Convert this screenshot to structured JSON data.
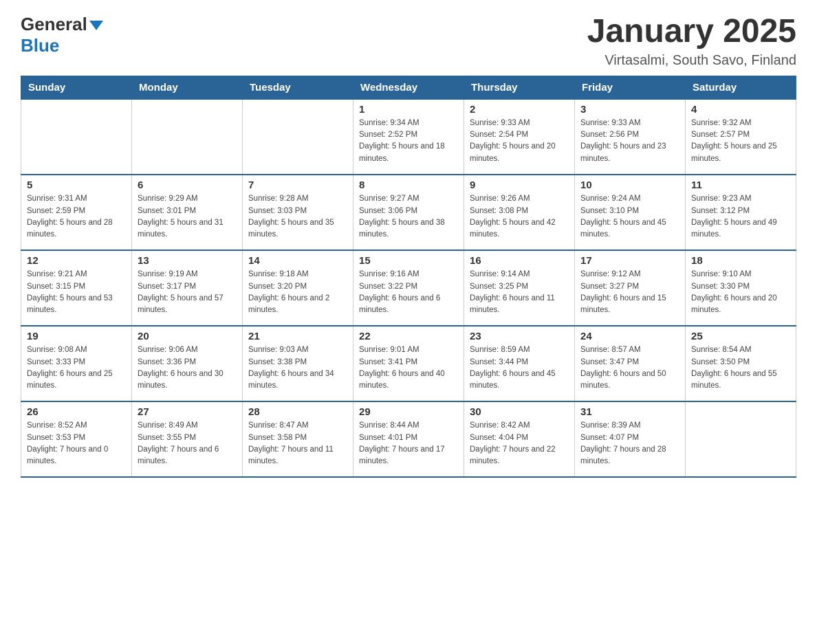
{
  "header": {
    "logo_general": "General",
    "logo_blue": "Blue",
    "month_title": "January 2025",
    "location": "Virtasalmi, South Savo, Finland"
  },
  "days_of_week": [
    "Sunday",
    "Monday",
    "Tuesday",
    "Wednesday",
    "Thursday",
    "Friday",
    "Saturday"
  ],
  "weeks": [
    [
      {
        "day": "",
        "sunrise": "",
        "sunset": "",
        "daylight": ""
      },
      {
        "day": "",
        "sunrise": "",
        "sunset": "",
        "daylight": ""
      },
      {
        "day": "",
        "sunrise": "",
        "sunset": "",
        "daylight": ""
      },
      {
        "day": "1",
        "sunrise": "Sunrise: 9:34 AM",
        "sunset": "Sunset: 2:52 PM",
        "daylight": "Daylight: 5 hours and 18 minutes."
      },
      {
        "day": "2",
        "sunrise": "Sunrise: 9:33 AM",
        "sunset": "Sunset: 2:54 PM",
        "daylight": "Daylight: 5 hours and 20 minutes."
      },
      {
        "day": "3",
        "sunrise": "Sunrise: 9:33 AM",
        "sunset": "Sunset: 2:56 PM",
        "daylight": "Daylight: 5 hours and 23 minutes."
      },
      {
        "day": "4",
        "sunrise": "Sunrise: 9:32 AM",
        "sunset": "Sunset: 2:57 PM",
        "daylight": "Daylight: 5 hours and 25 minutes."
      }
    ],
    [
      {
        "day": "5",
        "sunrise": "Sunrise: 9:31 AM",
        "sunset": "Sunset: 2:59 PM",
        "daylight": "Daylight: 5 hours and 28 minutes."
      },
      {
        "day": "6",
        "sunrise": "Sunrise: 9:29 AM",
        "sunset": "Sunset: 3:01 PM",
        "daylight": "Daylight: 5 hours and 31 minutes."
      },
      {
        "day": "7",
        "sunrise": "Sunrise: 9:28 AM",
        "sunset": "Sunset: 3:03 PM",
        "daylight": "Daylight: 5 hours and 35 minutes."
      },
      {
        "day": "8",
        "sunrise": "Sunrise: 9:27 AM",
        "sunset": "Sunset: 3:06 PM",
        "daylight": "Daylight: 5 hours and 38 minutes."
      },
      {
        "day": "9",
        "sunrise": "Sunrise: 9:26 AM",
        "sunset": "Sunset: 3:08 PM",
        "daylight": "Daylight: 5 hours and 42 minutes."
      },
      {
        "day": "10",
        "sunrise": "Sunrise: 9:24 AM",
        "sunset": "Sunset: 3:10 PM",
        "daylight": "Daylight: 5 hours and 45 minutes."
      },
      {
        "day": "11",
        "sunrise": "Sunrise: 9:23 AM",
        "sunset": "Sunset: 3:12 PM",
        "daylight": "Daylight: 5 hours and 49 minutes."
      }
    ],
    [
      {
        "day": "12",
        "sunrise": "Sunrise: 9:21 AM",
        "sunset": "Sunset: 3:15 PM",
        "daylight": "Daylight: 5 hours and 53 minutes."
      },
      {
        "day": "13",
        "sunrise": "Sunrise: 9:19 AM",
        "sunset": "Sunset: 3:17 PM",
        "daylight": "Daylight: 5 hours and 57 minutes."
      },
      {
        "day": "14",
        "sunrise": "Sunrise: 9:18 AM",
        "sunset": "Sunset: 3:20 PM",
        "daylight": "Daylight: 6 hours and 2 minutes."
      },
      {
        "day": "15",
        "sunrise": "Sunrise: 9:16 AM",
        "sunset": "Sunset: 3:22 PM",
        "daylight": "Daylight: 6 hours and 6 minutes."
      },
      {
        "day": "16",
        "sunrise": "Sunrise: 9:14 AM",
        "sunset": "Sunset: 3:25 PM",
        "daylight": "Daylight: 6 hours and 11 minutes."
      },
      {
        "day": "17",
        "sunrise": "Sunrise: 9:12 AM",
        "sunset": "Sunset: 3:27 PM",
        "daylight": "Daylight: 6 hours and 15 minutes."
      },
      {
        "day": "18",
        "sunrise": "Sunrise: 9:10 AM",
        "sunset": "Sunset: 3:30 PM",
        "daylight": "Daylight: 6 hours and 20 minutes."
      }
    ],
    [
      {
        "day": "19",
        "sunrise": "Sunrise: 9:08 AM",
        "sunset": "Sunset: 3:33 PM",
        "daylight": "Daylight: 6 hours and 25 minutes."
      },
      {
        "day": "20",
        "sunrise": "Sunrise: 9:06 AM",
        "sunset": "Sunset: 3:36 PM",
        "daylight": "Daylight: 6 hours and 30 minutes."
      },
      {
        "day": "21",
        "sunrise": "Sunrise: 9:03 AM",
        "sunset": "Sunset: 3:38 PM",
        "daylight": "Daylight: 6 hours and 34 minutes."
      },
      {
        "day": "22",
        "sunrise": "Sunrise: 9:01 AM",
        "sunset": "Sunset: 3:41 PM",
        "daylight": "Daylight: 6 hours and 40 minutes."
      },
      {
        "day": "23",
        "sunrise": "Sunrise: 8:59 AM",
        "sunset": "Sunset: 3:44 PM",
        "daylight": "Daylight: 6 hours and 45 minutes."
      },
      {
        "day": "24",
        "sunrise": "Sunrise: 8:57 AM",
        "sunset": "Sunset: 3:47 PM",
        "daylight": "Daylight: 6 hours and 50 minutes."
      },
      {
        "day": "25",
        "sunrise": "Sunrise: 8:54 AM",
        "sunset": "Sunset: 3:50 PM",
        "daylight": "Daylight: 6 hours and 55 minutes."
      }
    ],
    [
      {
        "day": "26",
        "sunrise": "Sunrise: 8:52 AM",
        "sunset": "Sunset: 3:53 PM",
        "daylight": "Daylight: 7 hours and 0 minutes."
      },
      {
        "day": "27",
        "sunrise": "Sunrise: 8:49 AM",
        "sunset": "Sunset: 3:55 PM",
        "daylight": "Daylight: 7 hours and 6 minutes."
      },
      {
        "day": "28",
        "sunrise": "Sunrise: 8:47 AM",
        "sunset": "Sunset: 3:58 PM",
        "daylight": "Daylight: 7 hours and 11 minutes."
      },
      {
        "day": "29",
        "sunrise": "Sunrise: 8:44 AM",
        "sunset": "Sunset: 4:01 PM",
        "daylight": "Daylight: 7 hours and 17 minutes."
      },
      {
        "day": "30",
        "sunrise": "Sunrise: 8:42 AM",
        "sunset": "Sunset: 4:04 PM",
        "daylight": "Daylight: 7 hours and 22 minutes."
      },
      {
        "day": "31",
        "sunrise": "Sunrise: 8:39 AM",
        "sunset": "Sunset: 4:07 PM",
        "daylight": "Daylight: 7 hours and 28 minutes."
      },
      {
        "day": "",
        "sunrise": "",
        "sunset": "",
        "daylight": ""
      }
    ]
  ]
}
